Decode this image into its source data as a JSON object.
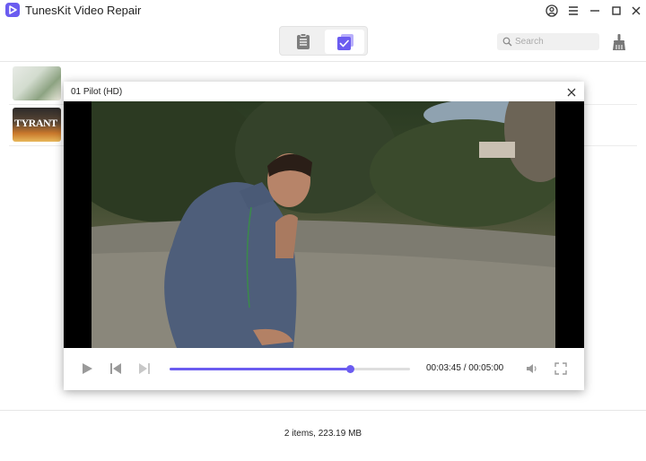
{
  "app": {
    "title": "TunesKit Video Repair",
    "accent": "#6b5cf0"
  },
  "window_controls": [
    "account-icon",
    "menu-icon",
    "minimize-icon",
    "maximize-icon",
    "close-icon"
  ],
  "toolbar": {
    "modes": [
      {
        "name": "list-mode",
        "icon": "clipboard-icon",
        "active": false
      },
      {
        "name": "repaired-mode",
        "icon": "check-square-icon",
        "active": true
      }
    ],
    "search": {
      "placeholder": "Search"
    }
  },
  "files": [
    {
      "thumb_text": ""
    },
    {
      "thumb_text": "TYRANT"
    }
  ],
  "player": {
    "title": "01 Pilot (HD)",
    "current_time": "00:03:45",
    "separator": "/",
    "total_time": "00:05:00",
    "progress": 0.75
  },
  "footer": {
    "summary": "2 items, 223.19 MB"
  }
}
